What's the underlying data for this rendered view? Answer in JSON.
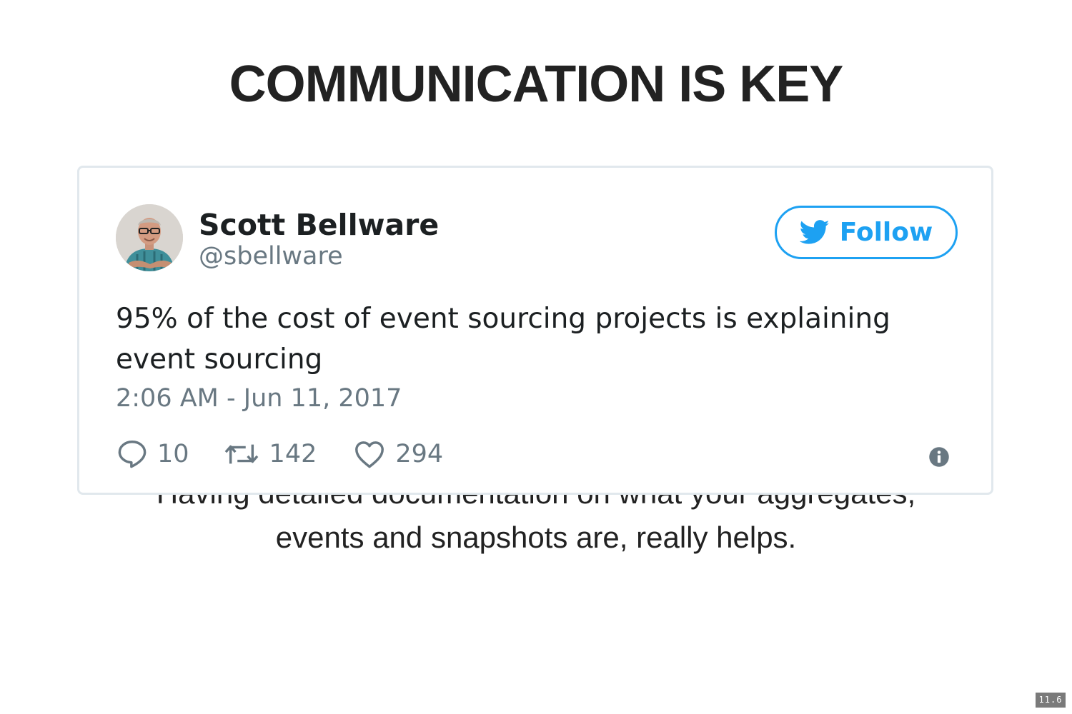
{
  "slide": {
    "title": "COMMUNICATION IS KEY",
    "body_lines": [
      "Having detailed documentation on what your aggregates,",
      "events and snapshots are, really helps."
    ],
    "page_number": "11.6"
  },
  "tweet": {
    "author_name": "Scott Bellware",
    "author_handle": "@sbellware",
    "follow_label": "Follow",
    "text_lines": [
      "95% of the cost of event sourcing projects is explaining",
      "event sourcing"
    ],
    "timestamp": "2:06 AM - Jun 11, 2017",
    "replies": "10",
    "retweets": "142",
    "likes": "294",
    "icons": {
      "follow": "twitter-bird-icon",
      "reply": "reply-icon",
      "retweet": "retweet-icon",
      "like": "heart-icon",
      "info": "info-icon"
    }
  },
  "colors": {
    "brand_blue": "#1da1f2",
    "secondary_text": "#697882",
    "primary_text": "#1c2022",
    "card_border": "#e1e8ed"
  }
}
